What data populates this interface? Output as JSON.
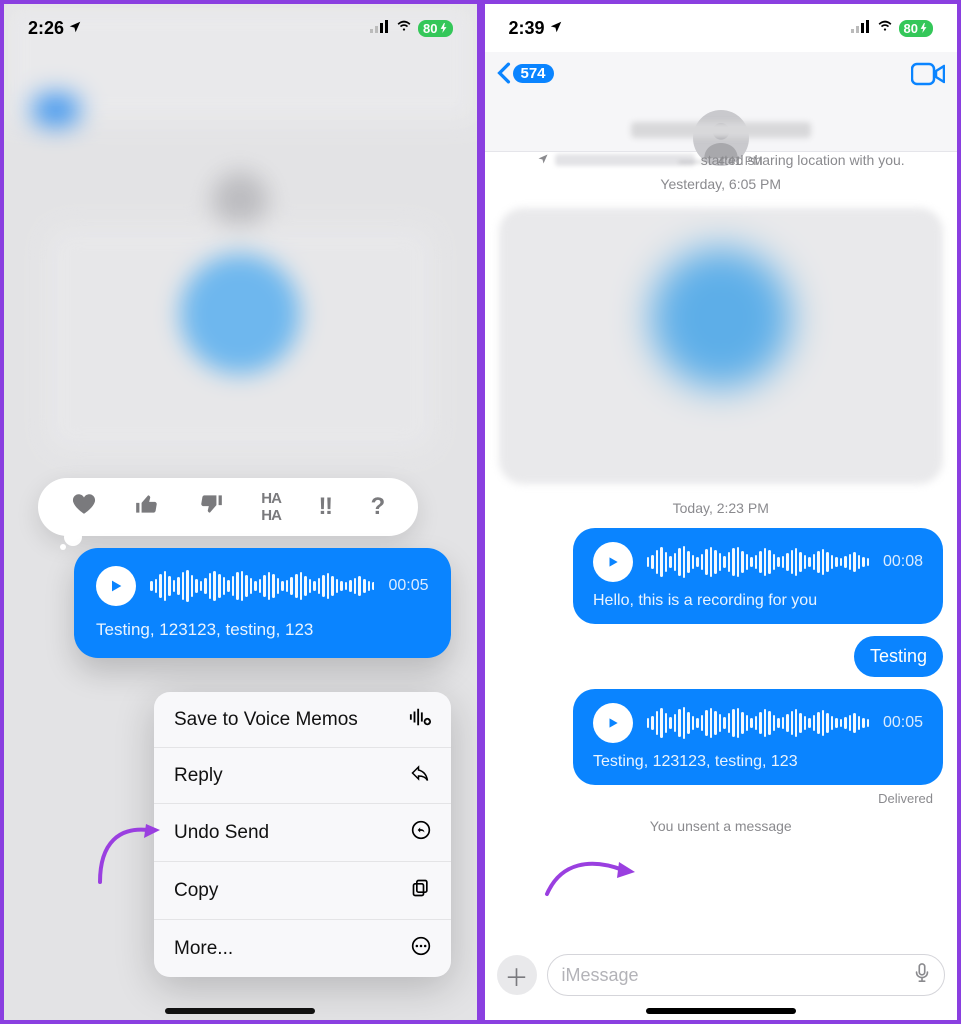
{
  "left": {
    "status": {
      "time": "2:26",
      "battery": "80"
    },
    "tapback": [
      "heart",
      "thumbs-up",
      "thumbs-down",
      "haha",
      "exclaim",
      "question"
    ],
    "voice_message": {
      "duration": "00:05",
      "transcript": "Testing, 123123, testing, 123"
    },
    "context_menu": [
      {
        "label": "Save to Voice Memos",
        "icon": "waveform-plus"
      },
      {
        "label": "Reply",
        "icon": "reply"
      },
      {
        "label": "Undo Send",
        "icon": "undo"
      },
      {
        "label": "Copy",
        "icon": "copy"
      },
      {
        "label": "More...",
        "icon": "more"
      }
    ]
  },
  "right": {
    "status": {
      "time": "2:39",
      "battery": "80"
    },
    "nav": {
      "back_count": "574"
    },
    "prev_time": "4:41 PM",
    "share_text": "started sharing location with you.",
    "divider1": "Yesterday, 6:05 PM",
    "divider2": "Today, 2:23 PM",
    "voice1": {
      "duration": "00:08",
      "transcript": "Hello, this is a recording for you"
    },
    "text_msg": "Testing",
    "voice2": {
      "duration": "00:05",
      "transcript": "Testing, 123123, testing, 123"
    },
    "delivered": "Delivered",
    "unsent": "You unsent a message",
    "compose_placeholder": "iMessage"
  }
}
